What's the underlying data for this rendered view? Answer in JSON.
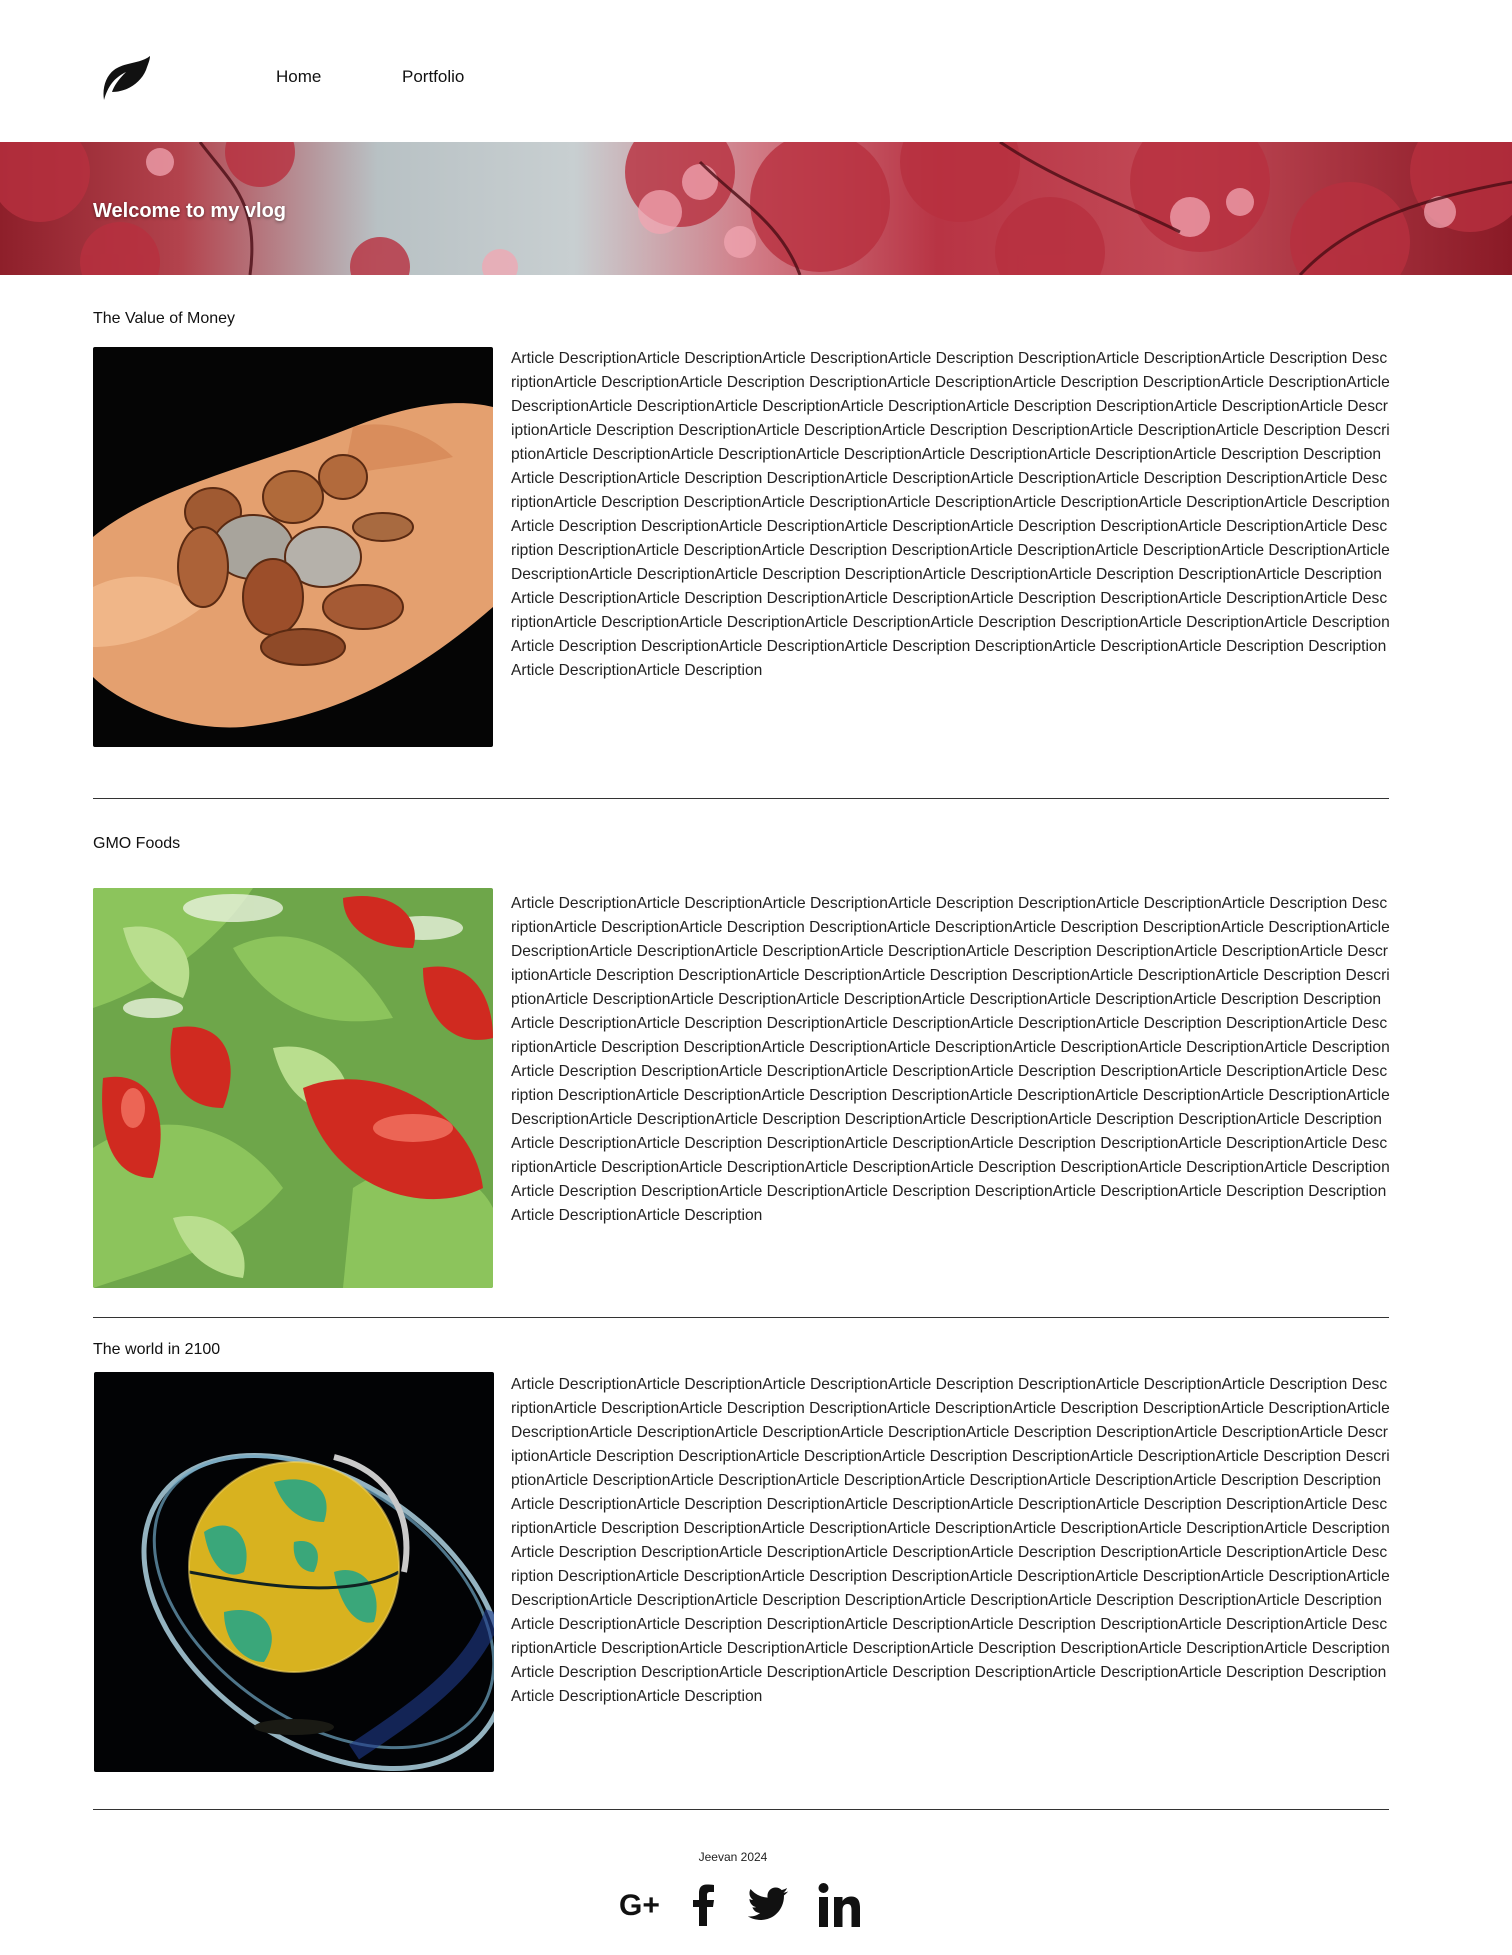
{
  "header": {
    "logo_icon": "leaf-icon",
    "nav": [
      {
        "label": "Home"
      },
      {
        "label": "Portfolio"
      }
    ]
  },
  "hero": {
    "title": "Welcome to my vlog"
  },
  "articles": [
    {
      "title": "The Value of Money",
      "image": "coins-in-hand-image",
      "description": "Article DescriptionArticle DescriptionArticle DescriptionArticle Description DescriptionArticle DescriptionArticle Description DescriptionArticle DescriptionArticle Description  DescriptionArticle DescriptionArticle Description DescriptionArticle DescriptionArticle DescriptionArticle DescriptionArticle DescriptionArticle DescriptionArticle Description DescriptionArticle DescriptionArticle DescriptionArticle Description DescriptionArticle DescriptionArticle Description DescriptionArticle DescriptionArticle Description DescriptionArticle DescriptionArticle DescriptionArticle DescriptionArticle DescriptionArticle DescriptionArticle Description DescriptionArticle DescriptionArticle Description DescriptionArticle DescriptionArticle DescriptionArticle Description  DescriptionArticle DescriptionArticle Description DescriptionArticle DescriptionArticle DescriptionArticle DescriptionArticle DescriptionArticle DescriptionArticle Description DescriptionArticle DescriptionArticle DescriptionArticle Description DescriptionArticle DescriptionArticle Description DescriptionArticle DescriptionArticle Description DescriptionArticle DescriptionArticle DescriptionArticle DescriptionArticle DescriptionArticle DescriptionArticle Description DescriptionArticle DescriptionArticle Description DescriptionArticle DescriptionArticle DescriptionArticle Description  DescriptionArticle DescriptionArticle Description DescriptionArticle DescriptionArticle DescriptionArticle DescriptionArticle DescriptionArticle DescriptionArticle Description DescriptionArticle DescriptionArticle DescriptionArticle Description DescriptionArticle DescriptionArticle Description DescriptionArticle DescriptionArticle Description DescriptionArticle DescriptionArticle Description"
    },
    {
      "title": "GMO Foods",
      "image": "salad-image",
      "description": "Article DescriptionArticle DescriptionArticle DescriptionArticle Description DescriptionArticle DescriptionArticle Description DescriptionArticle DescriptionArticle Description  DescriptionArticle DescriptionArticle Description DescriptionArticle DescriptionArticle DescriptionArticle DescriptionArticle DescriptionArticle DescriptionArticle Description DescriptionArticle DescriptionArticle DescriptionArticle Description DescriptionArticle DescriptionArticle Description DescriptionArticle DescriptionArticle Description DescriptionArticle DescriptionArticle DescriptionArticle DescriptionArticle DescriptionArticle DescriptionArticle Description DescriptionArticle DescriptionArticle Description DescriptionArticle DescriptionArticle DescriptionArticle Description  DescriptionArticle DescriptionArticle Description DescriptionArticle DescriptionArticle DescriptionArticle DescriptionArticle DescriptionArticle DescriptionArticle Description DescriptionArticle DescriptionArticle DescriptionArticle Description DescriptionArticle DescriptionArticle Description DescriptionArticle DescriptionArticle Description DescriptionArticle DescriptionArticle DescriptionArticle DescriptionArticle DescriptionArticle DescriptionArticle Description DescriptionArticle DescriptionArticle Description DescriptionArticle DescriptionArticle DescriptionArticle Description  DescriptionArticle DescriptionArticle Description DescriptionArticle DescriptionArticle DescriptionArticle DescriptionArticle DescriptionArticle DescriptionArticle Description DescriptionArticle DescriptionArticle DescriptionArticle Description DescriptionArticle DescriptionArticle Description DescriptionArticle DescriptionArticle Description DescriptionArticle DescriptionArticle Description"
    },
    {
      "title": "The world in 2100",
      "image": "globe-image",
      "description": "Article DescriptionArticle DescriptionArticle DescriptionArticle Description DescriptionArticle DescriptionArticle Description DescriptionArticle DescriptionArticle Description  DescriptionArticle DescriptionArticle Description DescriptionArticle DescriptionArticle DescriptionArticle DescriptionArticle DescriptionArticle DescriptionArticle Description DescriptionArticle DescriptionArticle DescriptionArticle Description DescriptionArticle DescriptionArticle Description DescriptionArticle DescriptionArticle Description DescriptionArticle DescriptionArticle DescriptionArticle DescriptionArticle DescriptionArticle DescriptionArticle Description DescriptionArticle DescriptionArticle Description DescriptionArticle DescriptionArticle DescriptionArticle Description  DescriptionArticle DescriptionArticle Description DescriptionArticle DescriptionArticle DescriptionArticle DescriptionArticle DescriptionArticle DescriptionArticle Description DescriptionArticle DescriptionArticle DescriptionArticle Description DescriptionArticle DescriptionArticle Description DescriptionArticle DescriptionArticle Description DescriptionArticle DescriptionArticle DescriptionArticle DescriptionArticle DescriptionArticle DescriptionArticle Description DescriptionArticle DescriptionArticle Description DescriptionArticle DescriptionArticle DescriptionArticle Description  DescriptionArticle DescriptionArticle Description DescriptionArticle DescriptionArticle DescriptionArticle DescriptionArticle DescriptionArticle DescriptionArticle Description DescriptionArticle DescriptionArticle DescriptionArticle Description DescriptionArticle DescriptionArticle Description DescriptionArticle DescriptionArticle Description DescriptionArticle DescriptionArticle Description"
    }
  ],
  "footer": {
    "credit": "Jeevan 2024",
    "social": [
      {
        "icon": "google-plus-icon",
        "label": "G+"
      },
      {
        "icon": "facebook-icon",
        "label": "f"
      },
      {
        "icon": "twitter-icon"
      },
      {
        "icon": "linkedin-icon",
        "label": "in"
      }
    ]
  },
  "colors": {
    "hero_red": "#a3202f",
    "divider": "#333333",
    "text": "#111111"
  }
}
